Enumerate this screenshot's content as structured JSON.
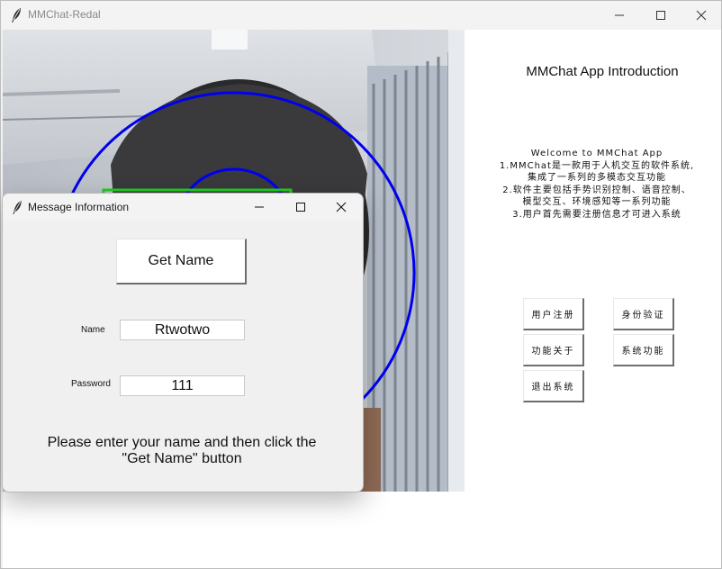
{
  "window": {
    "title": "MMChat-Redal",
    "controls": [
      "minimize-icon",
      "maximize-icon",
      "close-icon"
    ]
  },
  "intro": {
    "title": "MMChat App Introduction",
    "text": "Welcome to MMChat App\n1.MMChat是一款用于人机交互的软件系统,\n集成了一系列的多模态交互功能\n2.软件主要包括手势识别控制、语音控制、\n模型交互、环境感知等一系列功能\n3.用户首先需要注册信息才可进入系统"
  },
  "buttons": {
    "register": "用户注册",
    "verify": "身份验证",
    "about": "功能关于",
    "system": "系统功能",
    "exit": "退出系统"
  },
  "dialog": {
    "title": "Message Information",
    "get_name_label": "Get Name",
    "name_label": "Name",
    "name_value": "Rtwotwo",
    "password_label": "Password",
    "password_value": "111",
    "hint": "Please enter your name and then click the \"Get Name\" button"
  },
  "colors": {
    "face_circle": "#0000ee",
    "face_box": "#22cc22"
  }
}
